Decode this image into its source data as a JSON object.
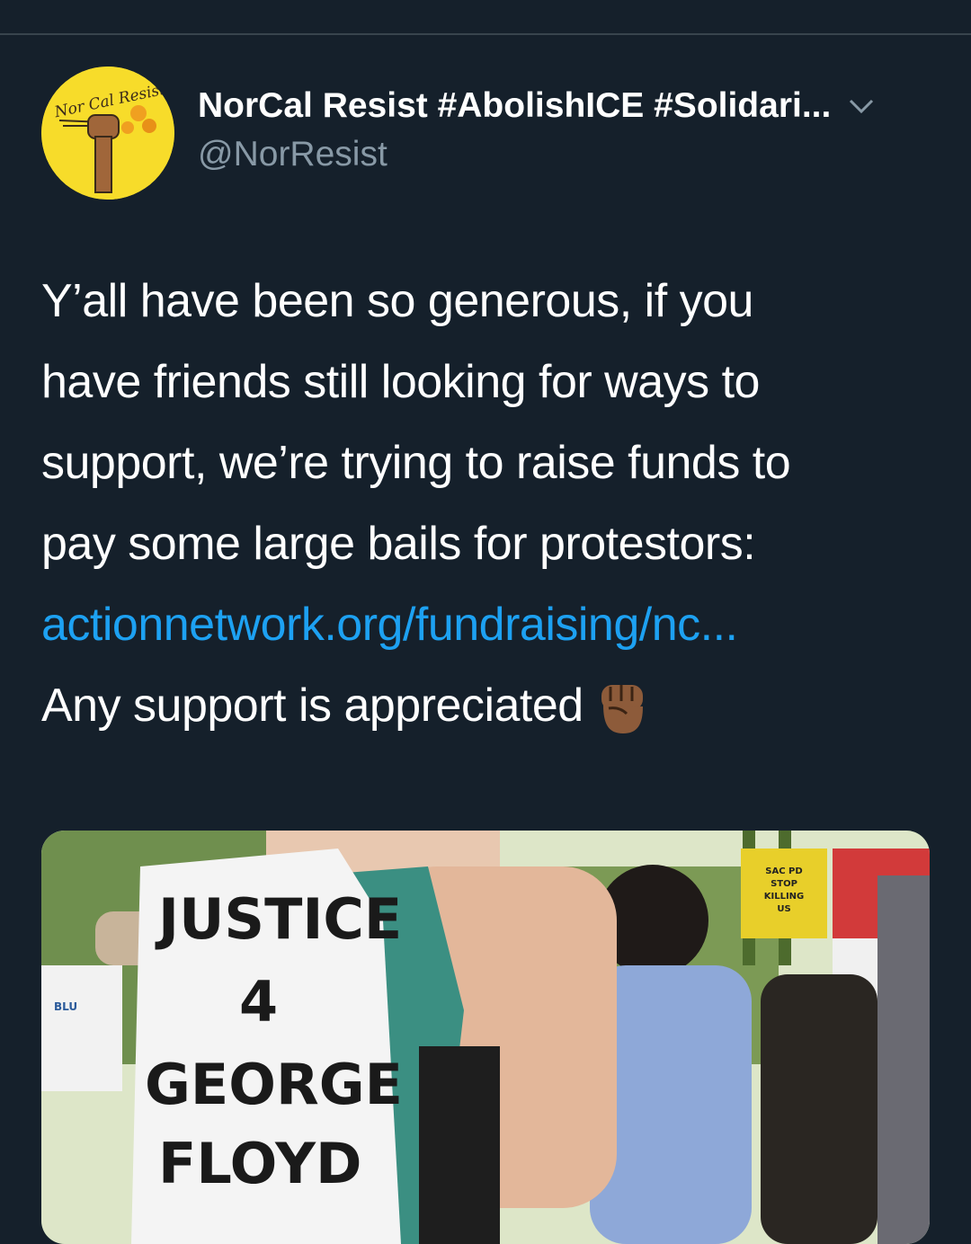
{
  "tweet": {
    "author": {
      "display_name": "NorCal Resist #AbolishICE #Solidari...",
      "handle": "@NorResist",
      "avatar_text": "Nor Cal Resist",
      "avatar_color": "#f7dc2a"
    },
    "text_lines": [
      "Y’all have been so generous, if you",
      "have friends still looking for ways to",
      "support, we’re trying to raise funds to",
      "pay some large bails for protestors:"
    ],
    "link": "actionnetwork.org/fundraising/nc...",
    "closing": "Any support is appreciated",
    "emoji": "raised-fist-medium-dark-skin",
    "link_color": "#1da1f2",
    "background_color": "#15202b",
    "media": {
      "sign_text": [
        "JUSTICE",
        "4",
        "GEORGE",
        "FLOYD"
      ],
      "placard_text": [
        "SAC PD",
        "STOP",
        "KILLING",
        "US"
      ],
      "left_sign_text": "BLU"
    }
  }
}
